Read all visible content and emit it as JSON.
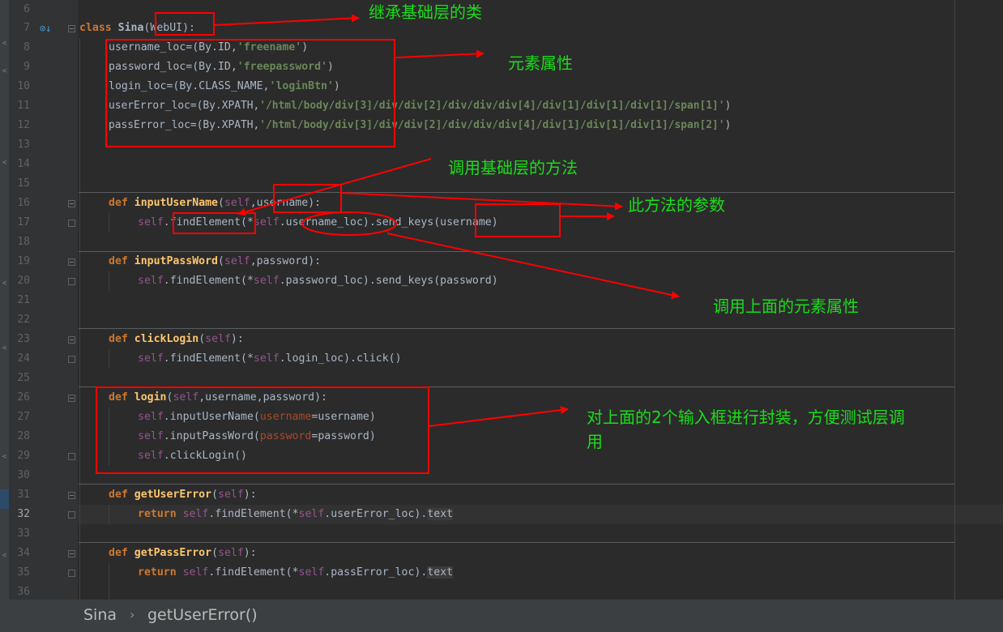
{
  "editor": {
    "line_numbers": [
      "6",
      "7",
      "8",
      "9",
      "10",
      "11",
      "12",
      "13",
      "14",
      "15",
      "16",
      "17",
      "18",
      "19",
      "20",
      "21",
      "22",
      "23",
      "24",
      "25",
      "26",
      "27",
      "28",
      "29",
      "30",
      "31",
      "32",
      "33",
      "34",
      "35",
      "36"
    ],
    "current_line": "32"
  },
  "code": {
    "l7": {
      "kw": "class",
      "name": "Sina",
      "open": "(",
      "base": "WebUI",
      "close": "):"
    },
    "l8": {
      "pre": "username_loc=(By.ID,",
      "str": "'freename'",
      "post": ")"
    },
    "l9": {
      "pre": "password_loc=(By.ID,",
      "str": "'freepassword'",
      "post": ")"
    },
    "l10": {
      "pre": "login_loc=(By.CLASS_NAME,",
      "str": "'loginBtn'",
      "post": ")"
    },
    "l11": {
      "pre": "userError_loc=(By.XPATH,",
      "str": "'/html/body/div[3]/div/div[2]/div/div/div[4]/div[1]/div[1]/div[1]/span[1]'",
      "post": ")"
    },
    "l12": {
      "pre": "passError_loc=(By.XPATH,",
      "str": "'/html/body/div[3]/div/div[2]/div/div/div[4]/div[1]/div[1]/div[1]/span[2]'",
      "post": ")"
    },
    "l16": {
      "kw": "def",
      "name": "inputUserName",
      "open": "(",
      "self": "self",
      "comma": ",",
      "param": "username",
      "close": "):"
    },
    "l17": {
      "self": "self",
      "a": ".findElement(*",
      "self2": "self",
      "b": ".username_loc).send_keys(username)"
    },
    "l19": {
      "kw": "def",
      "name": "inputPassWord",
      "open": "(",
      "self": "self",
      "comma": ",",
      "param": "password",
      "close": "):"
    },
    "l20": {
      "self": "self",
      "a": ".findElement(*",
      "self2": "self",
      "b": ".password_loc).send_keys(password)"
    },
    "l23": {
      "kw": "def",
      "name": "clickLogin",
      "open": "(",
      "self": "self",
      "close": "):"
    },
    "l24": {
      "self": "self",
      "a": ".findElement(*",
      "self2": "self",
      "b": ".login_loc).click()"
    },
    "l26": {
      "kw": "def",
      "name": "login",
      "open": "(",
      "self": "self",
      "rest": ",username,password):"
    },
    "l27": {
      "self": "self",
      "a": ".inputUserName(",
      "kwarg": "username",
      "b": "=username)"
    },
    "l28": {
      "self": "self",
      "a": ".inputPassWord(",
      "kwarg": "password",
      "b": "=password)"
    },
    "l29": {
      "self": "self",
      "a": ".clickLogin()"
    },
    "l31": {
      "kw": "def",
      "name": "getUserError",
      "open": "(",
      "self": "self",
      "close": "):"
    },
    "l32": {
      "kw": "return",
      "self": "self",
      "a": ".findElement(*",
      "self2": "self",
      "b": ".userError_loc).",
      "attr": "text"
    },
    "l34": {
      "kw": "def",
      "name": "getPassError",
      "open": "(",
      "self": "self",
      "close": "):"
    },
    "l35": {
      "kw": "return",
      "self": "self",
      "a": ".findElement(*",
      "self2": "self",
      "b": ".passError_loc).",
      "attr": "text"
    }
  },
  "annotations": {
    "inherit": "继承基础层的类",
    "attributes": "元素属性",
    "call_base": "调用基础层的方法",
    "param": "此方法的参数",
    "call_attr": "调用上面的元素属性",
    "wrap_line1": "对上面的2个输入框进行封装，方便测试层调",
    "wrap_line2": "用",
    "color": "#1bdc1b",
    "arrow_color": "#ff0000"
  },
  "breadcrumb": {
    "class_name": "Sina",
    "separator": "›",
    "method_name": "getUserError()"
  }
}
